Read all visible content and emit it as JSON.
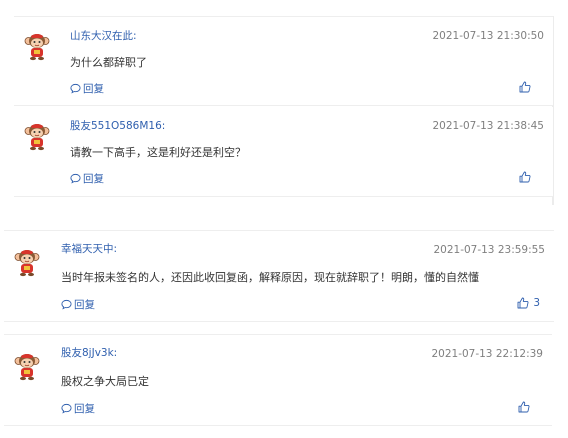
{
  "comments": [
    {
      "username": "山东大汉在此:",
      "time": "2021-07-13 21:30:50",
      "content": "为什么都辞职了",
      "reply_label": "回复",
      "like_count": ""
    },
    {
      "username": "股友551O586M16:",
      "time": "2021-07-13 21:38:45",
      "content": "请教一下高手，这是利好还是利空？",
      "reply_label": "回复",
      "like_count": ""
    },
    {
      "username": "幸福天天中:",
      "time": "2021-07-13 23:59:55",
      "content": "当时年报未签名的人，还因此收回复函，解释原因，现在就辞职了！明朗，懂的自然懂",
      "reply_label": "回复",
      "like_count": "3"
    },
    {
      "username": "股友8jJv3k:",
      "time": "2021-07-13 22:12:39",
      "content": "股权之争大局已定",
      "reply_label": "回复",
      "like_count": ""
    }
  ],
  "colors": {
    "link": "#2f5fae",
    "time": "#7f7f7f",
    "text": "#333333",
    "divider": "#eeeeee"
  },
  "icons": {
    "avatar": "monkey-avatar-icon",
    "reply": "speech-bubble-icon",
    "like": "thumbs-up-icon"
  }
}
